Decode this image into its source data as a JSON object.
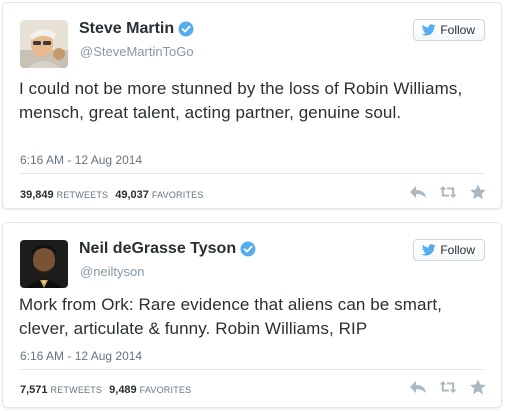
{
  "colors": {
    "twitter_blue": "#55acee",
    "text": "#292f33",
    "muted": "#8899a6",
    "border": "#e1e8ed"
  },
  "tweets": [
    {
      "display_name": "Steve Martin",
      "handle": "@SteveMartinToGo",
      "verified": true,
      "avatar_icon": "avatar-photo-steve-martin",
      "follow_label": "Follow",
      "text": "I could not be more stunned by the loss of Robin Williams, mensch, great talent, acting partner, genuine soul.",
      "timestamp": "6:16 AM - 12 Aug 2014",
      "retweets": "39,849",
      "retweets_label": "RETWEETS",
      "favorites": "49,037",
      "favorites_label": "FAVORITES",
      "actions": [
        "reply-icon",
        "retweet-icon",
        "favorite-icon"
      ]
    },
    {
      "display_name": "Neil deGrasse Tyson",
      "handle": "@neiltyson",
      "verified": true,
      "avatar_icon": "avatar-photo-neil-degrasse-tyson",
      "follow_label": "Follow",
      "text": "Mork from Ork: Rare evidence that aliens can be smart, clever, articulate & funny.  Robin Williams, RIP",
      "timestamp": "6:16 AM - 12 Aug 2014",
      "retweets": "7,571",
      "retweets_label": "RETWEETS",
      "favorites": "9,489",
      "favorites_label": "FAVORITES",
      "actions": [
        "reply-icon",
        "retweet-icon",
        "favorite-icon"
      ]
    }
  ]
}
